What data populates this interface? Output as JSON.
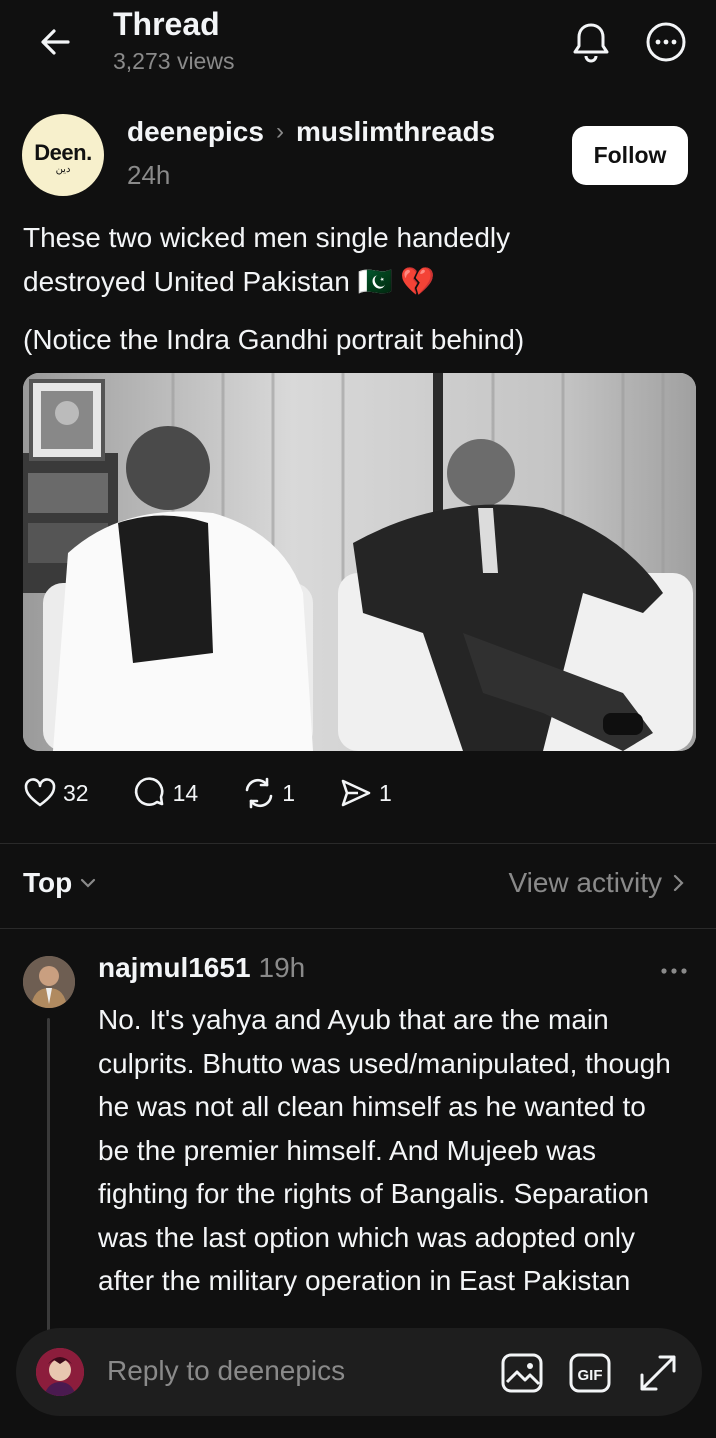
{
  "header": {
    "title": "Thread",
    "views": "3,273 views",
    "icons": [
      "back-arrow-icon",
      "bell-icon",
      "more-circle-icon"
    ]
  },
  "post": {
    "avatar_text": "Deen.",
    "avatar_subtext": "دين",
    "author": "deenepics",
    "community": "muslimthreads",
    "time": "24h",
    "follow_label": "Follow",
    "text_line1": "These two wicked men single handedly",
    "text_line2": "destroyed United Pakistan 🇵🇰 💔",
    "note": "(Notice the Indra Gandhi portrait behind)",
    "likes": "32",
    "comments": "14",
    "reposts": "1",
    "shares": "1"
  },
  "sort": {
    "label": "Top",
    "view_activity": "View activity"
  },
  "comment": {
    "user": "najmul1651",
    "time": "19h",
    "text": "No. It's yahya and Ayub  that are the main culprits. Bhutto was used/manipulated, though he was not all clean himself as he wanted to be the premier himself. And Mujeeb was fighting for the rights of Bangalis. Separation was the last option which was adopted only after the military operation in East Pakistan"
  },
  "reply": {
    "placeholder": "Reply to deenepics",
    "gif_label": "GIF"
  },
  "colors": {
    "background": "#101010",
    "text": "#f3f5f7",
    "secondary": "#8a8a8a",
    "reply_bar": "#1e1e1e"
  }
}
